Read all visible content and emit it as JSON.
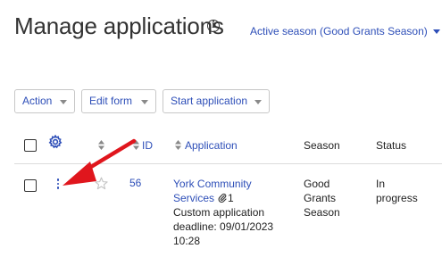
{
  "header": {
    "title": "Manage applications",
    "info_icon": "info-icon",
    "season_selector": "Active season (Good Grants Season)"
  },
  "toolbar": {
    "action_label": "Action",
    "edit_form_label": "Edit form",
    "start_application_label": "Start application"
  },
  "table": {
    "columns": {
      "id": "ID",
      "application": "Application",
      "season": "Season",
      "status": "Status"
    },
    "rows": [
      {
        "id": "56",
        "application_name": "York Community Services",
        "attachments": "1",
        "deadline": "Custom application deadline: 09/01/2023 10:28",
        "season": "Good Grants Season",
        "status": "In progress",
        "starred": false
      }
    ]
  },
  "annotation": {
    "arrow_color": "#e0161d"
  },
  "colors": {
    "link": "#2e4fb8",
    "text": "#222222",
    "border": "#c7c7c7"
  }
}
